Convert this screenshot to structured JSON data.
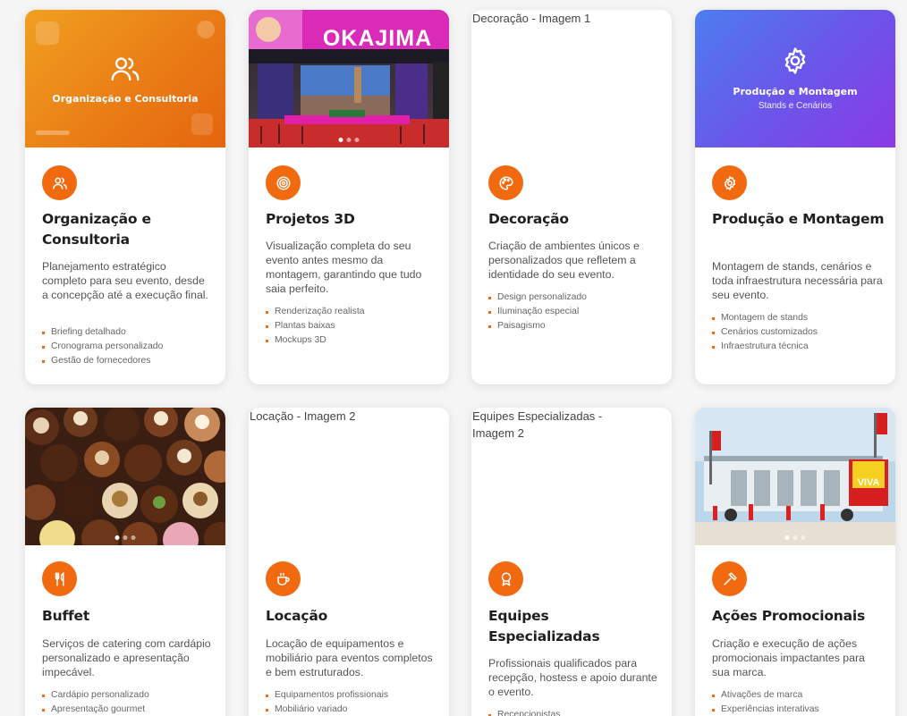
{
  "colors": {
    "accent": "#f26a10",
    "card_bg": "#ffffff",
    "page_bg": "#f5f5f5"
  },
  "cards": [
    {
      "id": "organizacao",
      "banner_title": "Organização e Consultoria",
      "title": "Organização e Consultoria",
      "icon": "users-icon",
      "description": "Planejamento estratégico completo para seu evento, desde a concepção até a execução final.",
      "features": [
        "Briefing detalhado",
        "Cronograma personalizado",
        "Gestão de fornecedores"
      ]
    },
    {
      "id": "projetos3d",
      "image_sign": "OKAJIMA",
      "title": "Projetos 3D",
      "icon": "target-icon",
      "description": "Visualização completa do seu evento antes mesmo da montagem, garantindo que tudo saia perfeito.",
      "features": [
        "Renderização realista",
        "Plantas baixas",
        "Mockups 3D"
      ]
    },
    {
      "id": "decoracao",
      "image_alt": "Decoração - Imagem 1",
      "title": "Decoração",
      "icon": "palette-icon",
      "description": "Criação de ambientes únicos e personalizados que refletem a identidade do seu evento.",
      "features": [
        "Design personalizado",
        "Iluminação especial",
        "Paisagismo"
      ]
    },
    {
      "id": "producao",
      "banner_title": "Produção e Montagem",
      "banner_subtitle": "Stands e Cenários",
      "title": "Produção e Montagem",
      "icon": "gear-icon",
      "description": "Montagem de stands, cenários e toda infraestrutura necessária para seu evento.",
      "features": [
        "Montagem de stands",
        "Cenários customizados",
        "Infraestrutura técnica"
      ]
    },
    {
      "id": "buffet",
      "title": "Buffet",
      "icon": "utensils-icon",
      "description": "Serviços de catering com cardápio personalizado e apresentação impecável.",
      "features": [
        "Cardápio personalizado",
        "Apresentação gourmet"
      ]
    },
    {
      "id": "locacao",
      "image_alt": "Locação - Imagem 2",
      "title": "Locação",
      "icon": "cup-icon",
      "description": "Locação de equipamentos e mobiliário para eventos completos e bem estruturados.",
      "features": [
        "Equipamentos profissionais",
        "Mobiliário variado"
      ]
    },
    {
      "id": "equipes",
      "image_alt": "Equipes Especializadas - Imagem 2",
      "title": "Equipes Especializadas",
      "icon": "award-icon",
      "description": "Profissionais qualificados para recepção, hostess e apoio durante o evento.",
      "features": [
        "Recepcionistas"
      ]
    },
    {
      "id": "acoes",
      "image_sign": "VIVA",
      "title": "Ações Promocionais",
      "icon": "hammer-icon",
      "description": "Criação e execução de ações promocionais impactantes para sua marca.",
      "features": [
        "Ativações de marca",
        "Experiências interativas"
      ]
    }
  ]
}
